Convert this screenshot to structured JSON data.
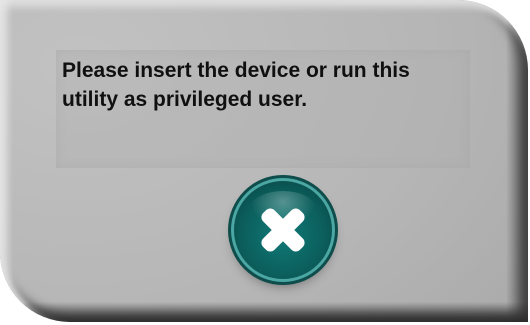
{
  "dialog": {
    "message": "Please insert the device or run this\nutility as privileged user.",
    "close_button": {
      "icon": "close-icon",
      "accent_color": "#0b5c5a"
    }
  }
}
